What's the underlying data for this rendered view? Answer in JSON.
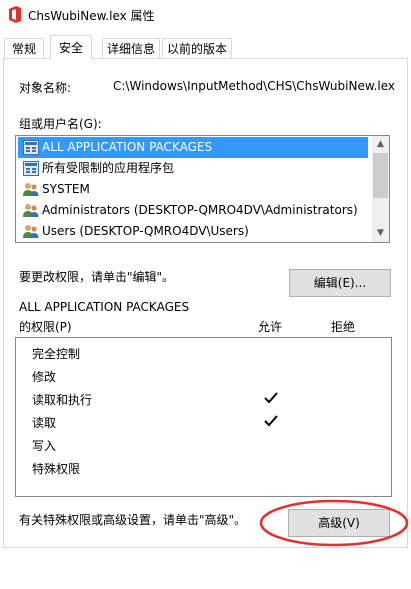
{
  "window": {
    "title": "ChsWubiNew.lex 属性",
    "icon": "office-file-icon",
    "accent_color": "#3399ff",
    "highlight_color": "#e0312e"
  },
  "tabs": [
    {
      "label": "常规",
      "active": false
    },
    {
      "label": "安全",
      "active": true
    },
    {
      "label": "详细信息",
      "active": false
    },
    {
      "label": "以前的版本",
      "active": false
    }
  ],
  "object": {
    "label": "对象名称:",
    "value": "C:\\Windows\\InputMethod\\CHS\\ChsWubiNew.lex"
  },
  "groups": {
    "label": "组或用户名(G):",
    "items": [
      {
        "label": "ALL APPLICATION PACKAGES",
        "icon": "app-package-icon",
        "selected": true
      },
      {
        "label": "所有受限制的应用程序包",
        "icon": "app-package-icon",
        "selected": false
      },
      {
        "label": "SYSTEM",
        "icon": "users-icon",
        "selected": false
      },
      {
        "label": "Administrators (DESKTOP-QMRO4DV\\Administrators)",
        "icon": "users-icon",
        "selected": false
      },
      {
        "label": "Users (DESKTOP-QMRO4DV\\Users)",
        "icon": "users-icon",
        "selected": false
      }
    ]
  },
  "edit": {
    "hint": "要更改权限，请单击\"编辑\"。",
    "button_label": "编辑(E)..."
  },
  "permissions": {
    "subject": "ALL APPLICATION PACKAGES",
    "label": "的权限(P)",
    "allow_header": "允许",
    "deny_header": "拒绝",
    "rows": [
      {
        "name": "完全控制",
        "allow": false,
        "deny": false
      },
      {
        "name": "修改",
        "allow": false,
        "deny": false
      },
      {
        "name": "读取和执行",
        "allow": true,
        "deny": false
      },
      {
        "name": "读取",
        "allow": true,
        "deny": false
      },
      {
        "name": "写入",
        "allow": false,
        "deny": false
      },
      {
        "name": "特殊权限",
        "allow": false,
        "deny": false
      }
    ]
  },
  "advanced": {
    "hint": "有关特殊权限或高级设置，请单击\"高级\"。",
    "button_label": "高级(V)"
  }
}
